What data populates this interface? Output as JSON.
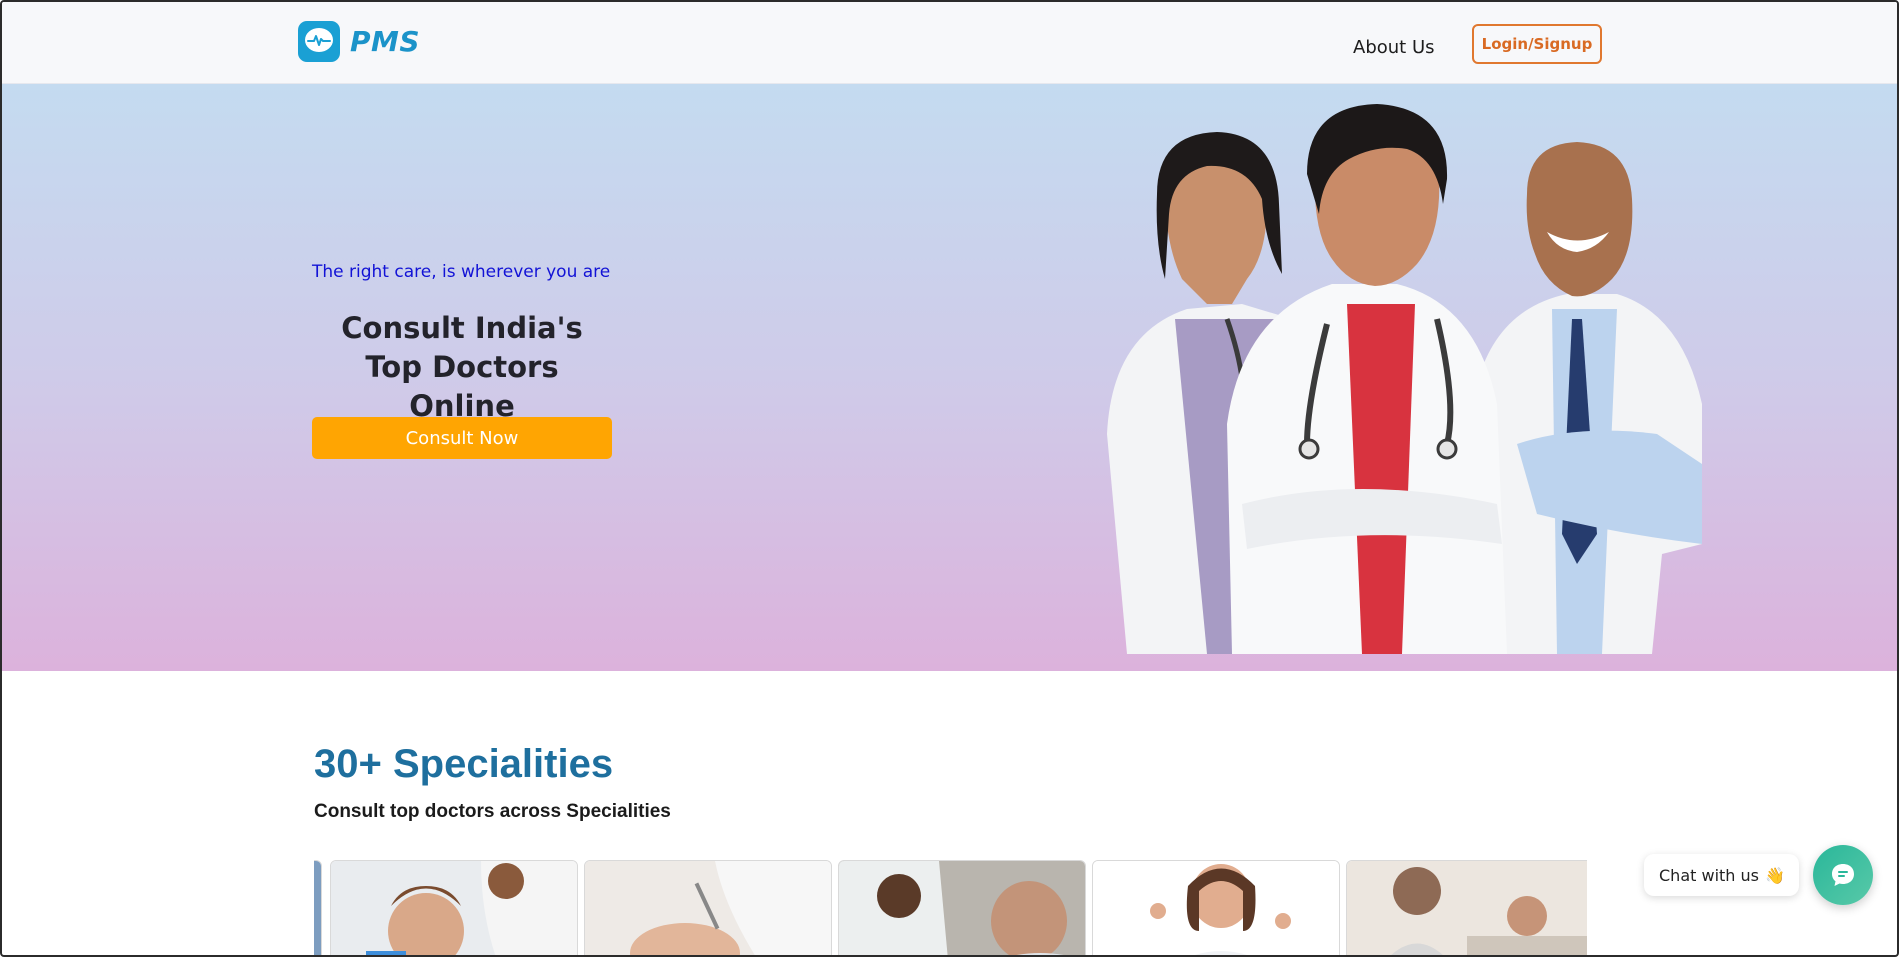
{
  "header": {
    "logo_text": "PMS",
    "nav_about": "About Us",
    "login_label": "Login/Signup"
  },
  "hero": {
    "tagline": "The right care, is wherever you are",
    "headline_line1": "Consult India's",
    "headline_line2": "Top Doctors Online",
    "cta_label": "Consult Now"
  },
  "specialities": {
    "title": "30+ Specialities",
    "subtitle": "Consult top doctors across Specialities",
    "cards": [
      "dentist-photo",
      "dermatology-photo",
      "cardiology-photo",
      "general-physician-photo",
      "psychiatry-photo"
    ]
  },
  "chat": {
    "pill_label": "Chat with us",
    "pill_emoji": "👋"
  },
  "colors": {
    "brand": "#1aa0d4",
    "login_border": "#e0782f",
    "cta": "#ffa502",
    "tagline": "#1212d6",
    "spec_title": "#1e6f9e",
    "chat_fab": "#2ab79a"
  }
}
